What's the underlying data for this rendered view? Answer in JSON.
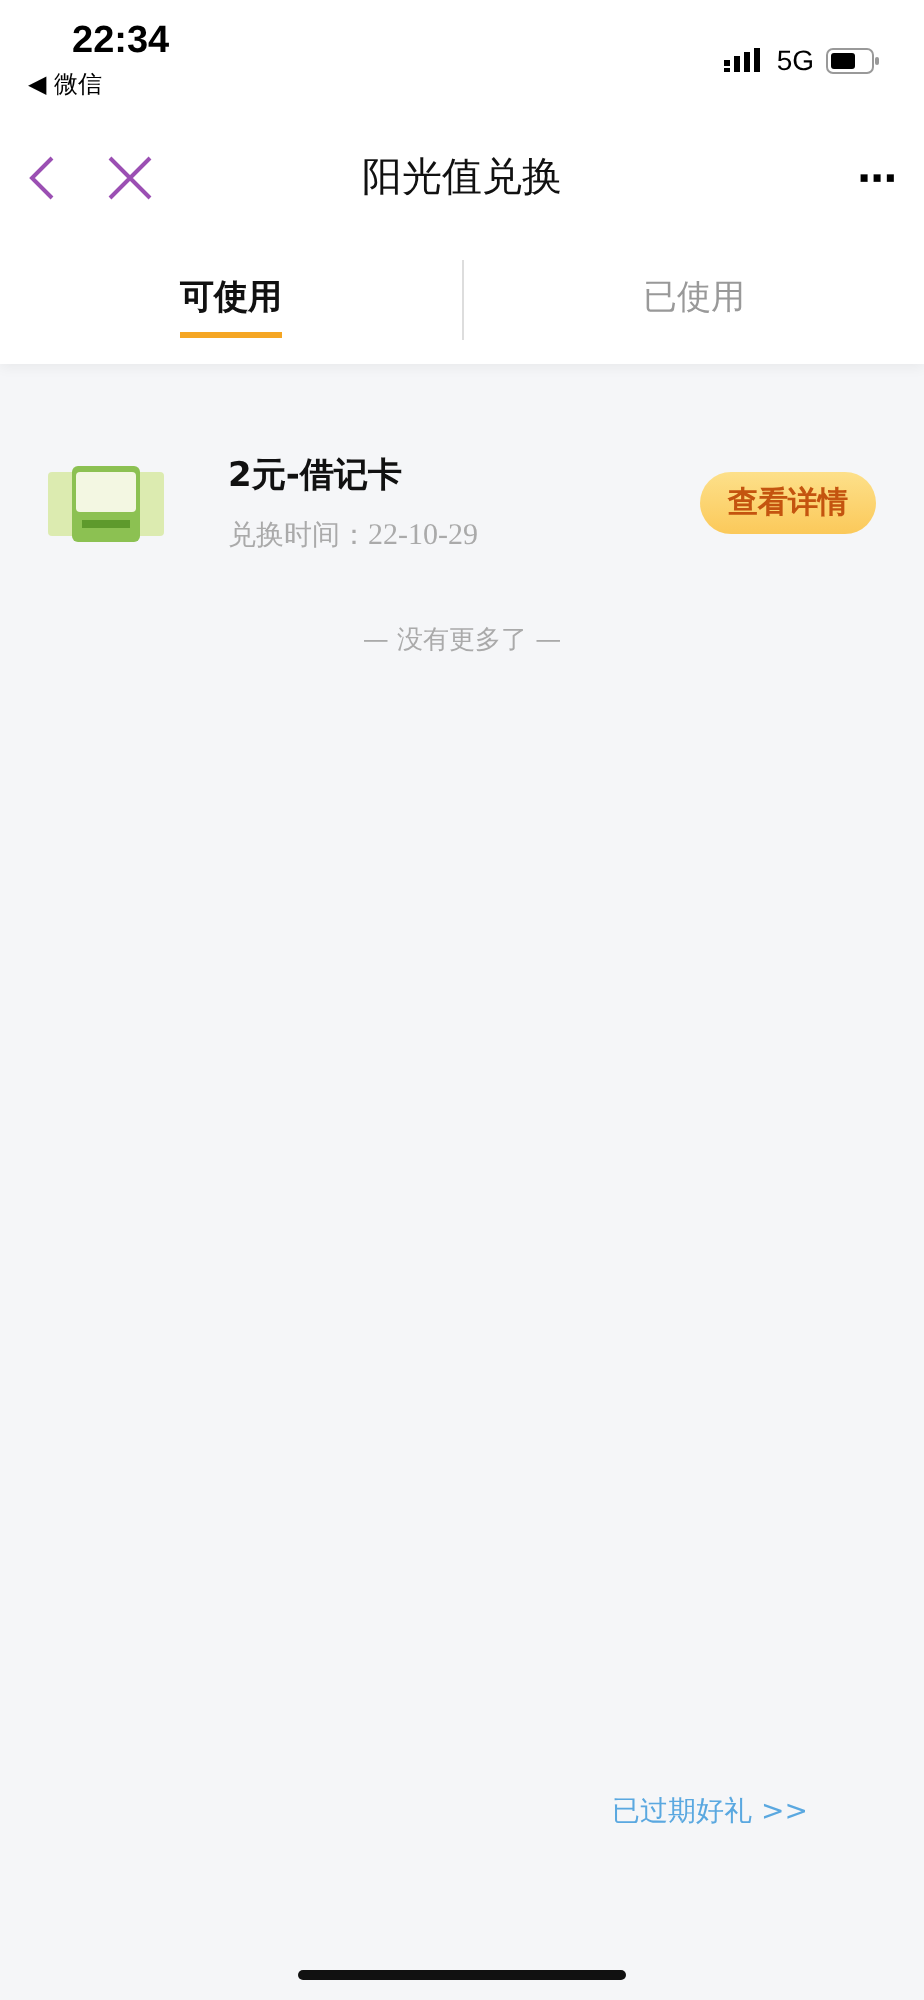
{
  "status_bar": {
    "time": "22:34",
    "back_app": "◀ 微信",
    "network": "5G"
  },
  "nav": {
    "title": "阳光值兑换",
    "more": "···"
  },
  "tabs": [
    {
      "label": "可使用",
      "selected": true
    },
    {
      "label": "已使用",
      "selected": false
    }
  ],
  "items": [
    {
      "title": "2元-借记卡",
      "date_label": "兑换时间：",
      "date": "22-10-29",
      "button": "查看详情"
    }
  ],
  "end_note": "— 没有更多了 —",
  "expired_link": "已过期好礼 >>"
}
